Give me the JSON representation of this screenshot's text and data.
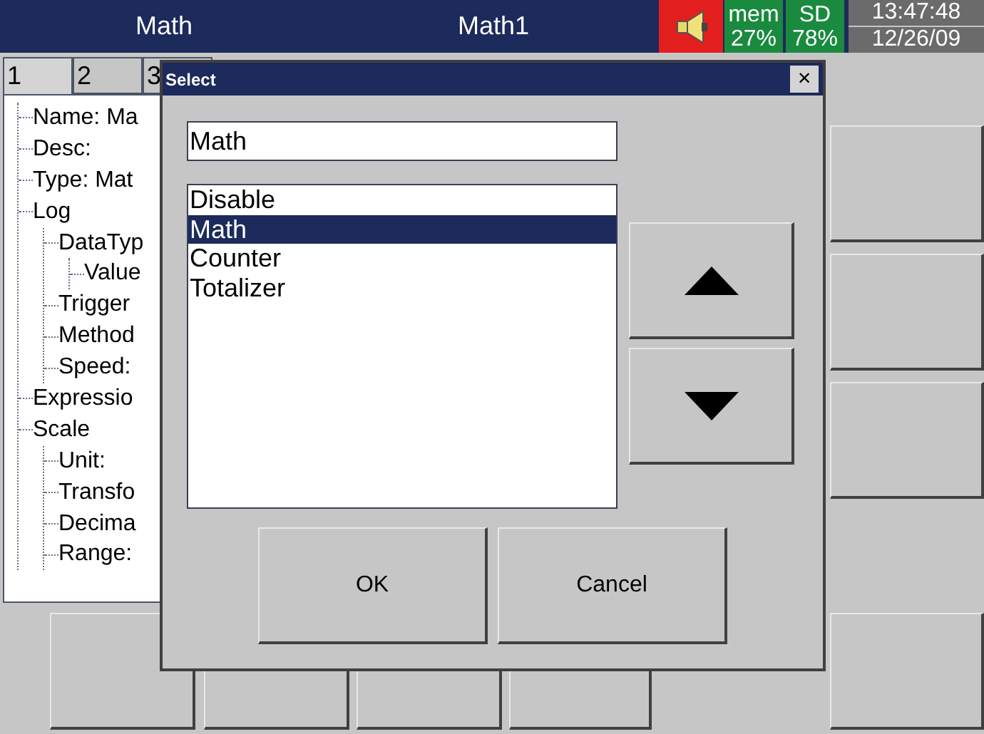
{
  "header": {
    "title": "Math",
    "subtitle": "Math1",
    "alarm": true,
    "mem_label": "mem",
    "mem_value": "27%",
    "sd_label": "SD",
    "sd_value": "78%",
    "time": "13:47:48",
    "date": "12/26/09"
  },
  "tabs": [
    {
      "label": "1",
      "selected": true
    },
    {
      "label": "2",
      "selected": false
    },
    {
      "label": "3",
      "selected": false
    }
  ],
  "tree": [
    {
      "label": "Name: Ma"
    },
    {
      "label": "Desc:"
    },
    {
      "label": "Type: Mat"
    },
    {
      "label": "Log",
      "children": [
        {
          "label": "DataTyp",
          "children": [
            {
              "label": "Value"
            }
          ]
        },
        {
          "label": "Trigger"
        },
        {
          "label": "Method"
        },
        {
          "label": "Speed:"
        }
      ]
    },
    {
      "label": "Expressio"
    },
    {
      "label": "Scale",
      "children": [
        {
          "label": "Unit:"
        },
        {
          "label": "Transfo"
        },
        {
          "label": "Decima"
        },
        {
          "label": "Range:"
        }
      ]
    }
  ],
  "dialog": {
    "title": "Select",
    "close": "×",
    "value": "Math",
    "options": [
      {
        "label": "Disable",
        "selected": false
      },
      {
        "label": "Math",
        "selected": true
      },
      {
        "label": "Counter",
        "selected": false
      },
      {
        "label": "Totalizer",
        "selected": false
      }
    ],
    "buttons": [
      "OK",
      "Cancel"
    ]
  }
}
